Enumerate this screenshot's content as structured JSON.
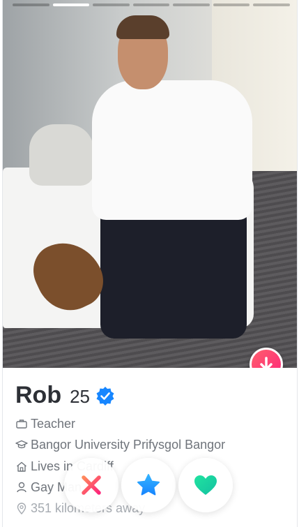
{
  "progress": {
    "segments": 7,
    "active_index": 1
  },
  "profile": {
    "name": "Rob",
    "age": "25",
    "verified": true,
    "job": "Teacher",
    "school": "Bangor University Prifysgol Bangor",
    "lives": "Lives in Cardiff",
    "gender": "Gay Man",
    "distance": "351 kilometers away"
  },
  "colors": {
    "accent": "#fd267a",
    "verified": "#1786ff",
    "nope": "#fd5068",
    "super_like": "#1786ff",
    "like": "#1ed19b"
  },
  "icons": {
    "job": "briefcase-icon",
    "school": "graduation-cap-icon",
    "lives": "house-icon",
    "gender": "person-icon",
    "distance": "location-pin-icon",
    "nope": "close-icon",
    "super_like": "star-icon",
    "like": "heart-icon",
    "open_profile": "arrow-down-icon"
  }
}
